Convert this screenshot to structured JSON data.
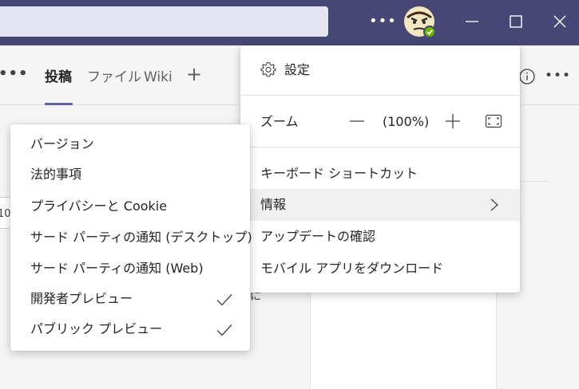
{
  "titlebar": {
    "more_label": "•••",
    "colors": {
      "bar": "#464775",
      "search_box": "#e5e5f1",
      "status_available": "#6bb700"
    }
  },
  "channel_tabs": {
    "overflow_label": "•••",
    "posts": "投稿",
    "files": "ファイル",
    "wiki": "Wiki",
    "add_label": "+",
    "right_more_label": "•••"
  },
  "background": {
    "input_fragment": "10",
    "text_fragment": "に"
  },
  "main_menu": {
    "settings": "設定",
    "zoom": {
      "label": "ズーム",
      "value": "(100%)"
    },
    "items": [
      {
        "label": "キーボード ショートカット"
      },
      {
        "label": "情報"
      },
      {
        "label": "アップデートの確認"
      },
      {
        "label": "モバイル アプリをダウンロード"
      }
    ]
  },
  "about_menu": {
    "items": [
      {
        "label": "バージョン",
        "checked": false
      },
      {
        "label": "法的事項",
        "checked": false
      },
      {
        "label": "プライバシーと Cookie",
        "checked": false
      },
      {
        "label": "サード パーティの通知 (デスクトップ)",
        "checked": false
      },
      {
        "label": "サード パーティの通知 (Web)",
        "checked": false
      },
      {
        "label": "開発者プレビュー",
        "checked": true
      },
      {
        "label": "パブリック プレビュー",
        "checked": true
      }
    ]
  },
  "accent_color": "#6264a7"
}
